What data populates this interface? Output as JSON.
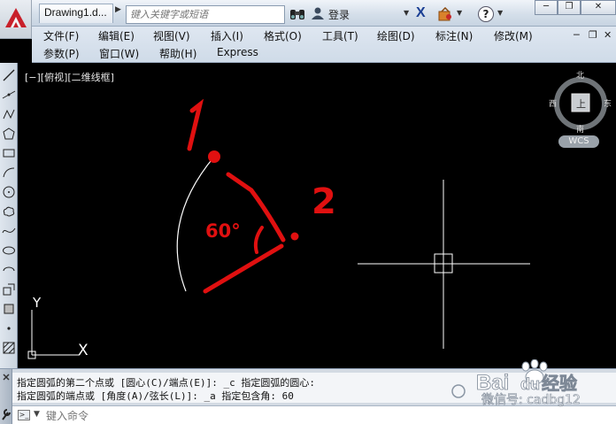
{
  "titlebar": {
    "doc_tab": "Drawing1.d...",
    "search_placeholder": "键入关键字或短语",
    "login_label": "登录",
    "icons": [
      "autocad-logo-icon",
      "binoculars-icon",
      "user-icon",
      "autodesk-x-icon",
      "exchange-icon",
      "help-icon"
    ],
    "window_buttons": [
      "minimize",
      "restore",
      "close"
    ]
  },
  "menubar": {
    "row1": [
      "文件(F)",
      "编辑(E)",
      "视图(V)",
      "插入(I)",
      "格式(O)",
      "工具(T)",
      "绘图(D)",
      "标注(N)",
      "修改(M)"
    ],
    "row2": [
      "参数(P)",
      "窗口(W)",
      "帮助(H)",
      "Express"
    ]
  },
  "viewport": {
    "label": "[−][俯视][二维线框]",
    "viewcube": {
      "north": "北",
      "south": "南",
      "east": "东",
      "west": "西",
      "top": "上"
    },
    "wcs": "WCS",
    "ucs": {
      "x": "X",
      "y": "Y"
    },
    "annotations": {
      "point1": "1",
      "point2": "2",
      "angle": "60°"
    },
    "colors": {
      "background": "#000000",
      "annotation": "#e01010",
      "arc": "#ffffff",
      "crosshair": "#ffffff"
    }
  },
  "command": {
    "history": [
      "指定圆弧的第二个点或 [圆心(C)/端点(E)]: _c 指定圆弧的圆心:",
      "指定圆弧的端点或 [角度(A)/弦长(L)]: _a 指定包含角: 60"
    ],
    "input_placeholder": "键入命令"
  },
  "watermark": {
    "brand": "Bai",
    "brand_mid": "du",
    "suffix": "经验",
    "credit": "微信号: cadbg12"
  }
}
